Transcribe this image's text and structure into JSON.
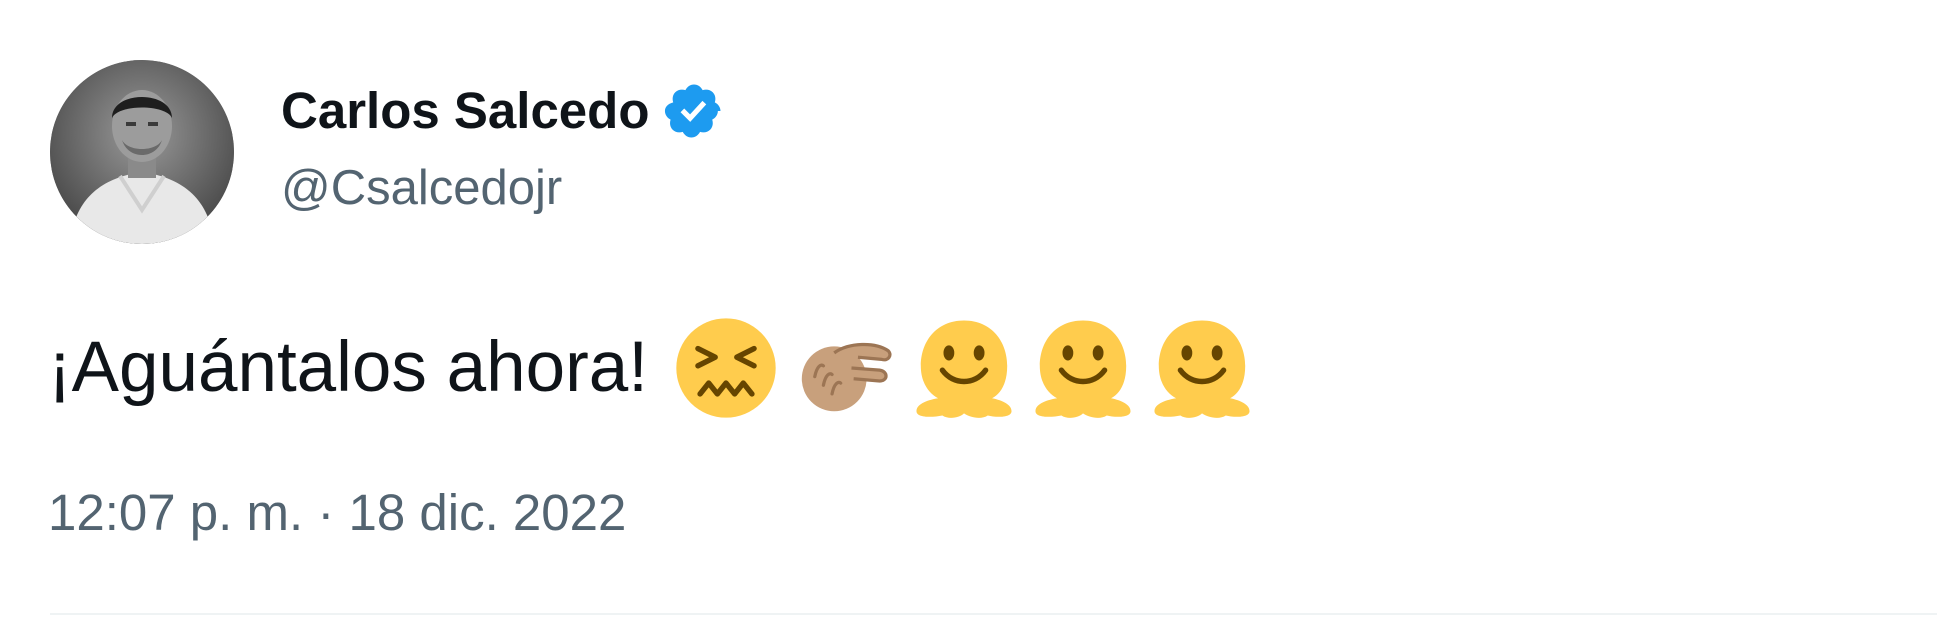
{
  "author": {
    "display_name": "Carlos Salcedo",
    "handle": "@Csalcedojr",
    "verified": true,
    "avatar_icon": "profile-photo",
    "verified_icon": "verified-badge-icon",
    "verified_color": "#1d9bf0"
  },
  "tweet": {
    "text": "¡Aguántalos ahora!",
    "emojis": [
      "confounded-face-emoji",
      "pinching-hand-emoji",
      "melting-face-emoji",
      "melting-face-emoji",
      "melting-face-emoji"
    ],
    "timestamp": "12:07 p. m. · 18 dic. 2022"
  },
  "colors": {
    "text_primary": "#0f1419",
    "text_secondary": "#536471",
    "divider": "#eff3f4",
    "emoji_yellow": "#ffcc4d",
    "skin_tone": "#c8a07c"
  }
}
